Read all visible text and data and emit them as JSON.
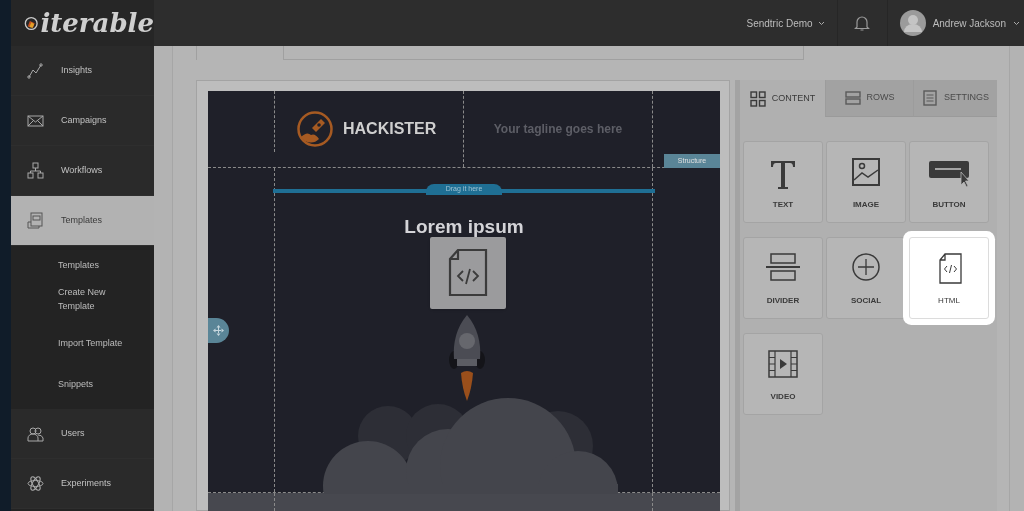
{
  "brand": {
    "name": "iterable"
  },
  "topbar": {
    "project": "Sendtric Demo",
    "user": "Andrew Jackson"
  },
  "sidebar": {
    "items": [
      {
        "label": "Insights",
        "selected": false
      },
      {
        "label": "Campaigns",
        "selected": false
      },
      {
        "label": "Workflows",
        "selected": false
      },
      {
        "label": "Templates",
        "selected": true,
        "expanded": true,
        "children": [
          {
            "label": "Templates"
          },
          {
            "label": "Create New Template"
          },
          {
            "label": "Import Template"
          },
          {
            "label": "Snippets"
          }
        ]
      },
      {
        "label": "Users",
        "selected": false
      },
      {
        "label": "Experiments",
        "selected": false
      }
    ]
  },
  "email": {
    "brand": "HACKISTER",
    "tagline": "Your tagline goes here",
    "structure_label": "Structure",
    "drop_label": "Drag it here",
    "heading": "Lorem ipsum"
  },
  "panel": {
    "tabs": [
      {
        "label": "CONTENT",
        "selected": true
      },
      {
        "label": "ROWS",
        "selected": false
      },
      {
        "label": "SETTINGS",
        "selected": false
      }
    ],
    "blocks": [
      {
        "label": "TEXT",
        "selected": false
      },
      {
        "label": "IMAGE",
        "selected": false
      },
      {
        "label": "BUTTON",
        "selected": false
      },
      {
        "label": "DIVIDER",
        "selected": false
      },
      {
        "label": "SOCIAL",
        "selected": false
      },
      {
        "label": "HTML",
        "selected": true
      },
      {
        "label": "VIDEO",
        "selected": false
      }
    ]
  }
}
